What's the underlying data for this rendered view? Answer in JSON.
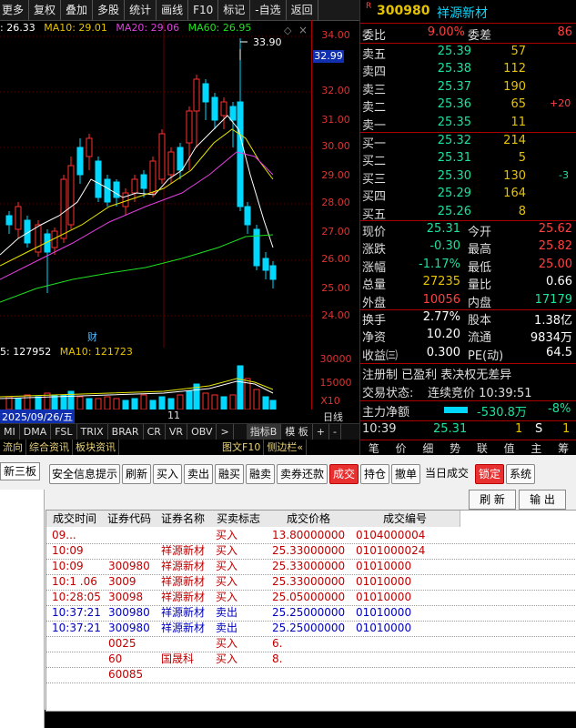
{
  "toolbar": {
    "items": [
      "更多",
      "复权",
      "叠加",
      "多股",
      "统计",
      "画线",
      "F10",
      "标记",
      "-自选",
      "返回"
    ]
  },
  "chart": {
    "ma_legend": {
      "ma5": ": 26.33",
      "ma10": "MA10: 29.01",
      "ma20": "MA20: 29.06",
      "ma60": "MA60: 26.95"
    },
    "high_marker": "33.90",
    "current_price_tag": "32.99",
    "price_ticks": [
      "34.00",
      "33.00",
      "32.00",
      "31.00",
      "30.00",
      "29.00",
      "28.00",
      "27.00",
      "26.00",
      "25.00",
      "24.00"
    ],
    "vol_legend": {
      "vol": "5: 127952",
      "ma10": "MA10: 121723"
    },
    "vol_ticks": [
      "30000",
      "15000",
      "X10"
    ],
    "event_label": "财",
    "date_label": "2025/09/26/五",
    "month_label": "11",
    "period_label": "日线",
    "plus": "+",
    "minus": "-"
  },
  "bottom_tabs": [
    "MI",
    "DMA",
    "FSL",
    "TRIX",
    "BRAR",
    "CR",
    "VR",
    "OBV",
    ">",
    "指标B",
    "模 板"
  ],
  "func_tabs": [
    "流向",
    "综合资讯",
    "板块资讯",
    "图文F10",
    "侧边栏«"
  ],
  "quote": {
    "code": "300980",
    "name": "祥源新材",
    "r_badge": "R",
    "weibi_label": "委比",
    "weibi": "9.00%",
    "weicha_label": "委差",
    "weicha": "86",
    "asks": [
      {
        "label": "卖五",
        "price": "25.39",
        "vol": "57",
        "extra": ""
      },
      {
        "label": "卖四",
        "price": "25.38",
        "vol": "112",
        "extra": ""
      },
      {
        "label": "卖三",
        "price": "25.37",
        "vol": "190",
        "extra": ""
      },
      {
        "label": "卖二",
        "price": "25.36",
        "vol": "65",
        "extra": "+20"
      },
      {
        "label": "卖一",
        "price": "25.35",
        "vol": "11",
        "extra": ""
      }
    ],
    "bids": [
      {
        "label": "买一",
        "price": "25.32",
        "vol": "214",
        "extra": ""
      },
      {
        "label": "买二",
        "price": "25.31",
        "vol": "5",
        "extra": ""
      },
      {
        "label": "买三",
        "price": "25.30",
        "vol": "130",
        "extra": "-3"
      },
      {
        "label": "买四",
        "price": "25.29",
        "vol": "164",
        "extra": ""
      },
      {
        "label": "买五",
        "price": "25.26",
        "vol": "8",
        "extra": ""
      }
    ],
    "stats": [
      {
        "l1": "现价",
        "v1": "25.31",
        "l2": "今开",
        "v2": "25.62"
      },
      {
        "l1": "涨跌",
        "v1": "-0.30",
        "l2": "最高",
        "v2": "25.82"
      },
      {
        "l1": "涨幅",
        "v1": "-1.17%",
        "l2": "最低",
        "v2": "25.00"
      },
      {
        "l1": "总量",
        "v1": "27235",
        "l2": "量比",
        "v2": "0.66"
      },
      {
        "l1": "外盘",
        "v1": "10056",
        "l2": "内盘",
        "v2": "17179"
      }
    ],
    "stats2": [
      {
        "l1": "换手",
        "v1": "2.77%",
        "l2": "股本",
        "v2": "1.38亿"
      },
      {
        "l1": "净资",
        "v1": "10.20",
        "l2": "流通",
        "v2": "9834万"
      },
      {
        "l1": "收益㈢",
        "v1": "0.300",
        "l2": "PE(动)",
        "v2": "64.5"
      }
    ],
    "tags": "注册制 已盈利 表决权无差异",
    "trade_status_label": "交易状态:",
    "trade_status": "连续竞价 10:39:51",
    "main_net_label": "主力净额",
    "main_net": "-530.8万",
    "main_net_pct": "-8%",
    "tick_time": "10:39",
    "tick_price": "25.31",
    "tick_vol": "1",
    "tick_side": "S",
    "tick_n": "1",
    "tabs": [
      "笔",
      "价",
      "细",
      "势",
      "联",
      "值",
      "主",
      "筹"
    ]
  },
  "trade": {
    "left_tab": "新三板",
    "buttons": [
      "安全信息提示",
      "刷新",
      "买入",
      "卖出",
      "融买",
      "融卖",
      "卖券还款",
      "成交",
      "持仓",
      "撤单",
      "当日成交",
      "锁定",
      "系统"
    ],
    "active_button": "成交",
    "refresh_label": "刷 新",
    "export_label": "输 出",
    "columns": [
      "成交时间",
      "证券代码",
      "证券名称",
      "买卖标志",
      "成交价格",
      "成交编号"
    ],
    "rows": [
      {
        "time": "09...",
        "code": "",
        "name": "",
        "side": "买入",
        "price": "13.80000000",
        "no": "0104000004"
      },
      {
        "time": "10:09",
        "code": "",
        "name": "祥源新材",
        "side": "买入",
        "price": "25.33000000",
        "no": "0101000024"
      },
      {
        "time": "10:09",
        "code": "300980",
        "name": "祥源新材",
        "side": "买入",
        "price": "25.33000000",
        "no": "01010000"
      },
      {
        "time": "10:1 .06",
        "code": "3009",
        "name": "祥源新材",
        "side": "买入",
        "price": "25.33000000",
        "no": "01010000"
      },
      {
        "time": "10:28:05",
        "code": "30098",
        "name": "祥源新材",
        "side": "买入",
        "price": "25.05000000",
        "no": "01010000"
      },
      {
        "time": "10:37:21",
        "code": "300980",
        "name": "祥源新材",
        "side": "卖出",
        "price": "25.25000000",
        "no": "01010000"
      },
      {
        "time": "10:37:21",
        "code": "300980",
        "name": "祥源新材",
        "side": "卖出",
        "price": "25.25000000",
        "no": "01010000"
      },
      {
        "time": "",
        "code": "0025",
        "name": "",
        "side": "买入",
        "price": "6.",
        "no": ""
      },
      {
        "time": "",
        "code": "60",
        "name": "国晟科",
        "side": "买入",
        "price": "8.",
        "no": ""
      },
      {
        "time": "",
        "code": "60085",
        "name": "",
        "side": "",
        "price": "",
        "no": ""
      }
    ]
  },
  "colors": {
    "up": "#ff3030",
    "down": "#00e0ff",
    "ma5": "#ffffff",
    "ma10": "#e6e600",
    "ma20": "#e040e0",
    "ma60": "#20e020"
  }
}
